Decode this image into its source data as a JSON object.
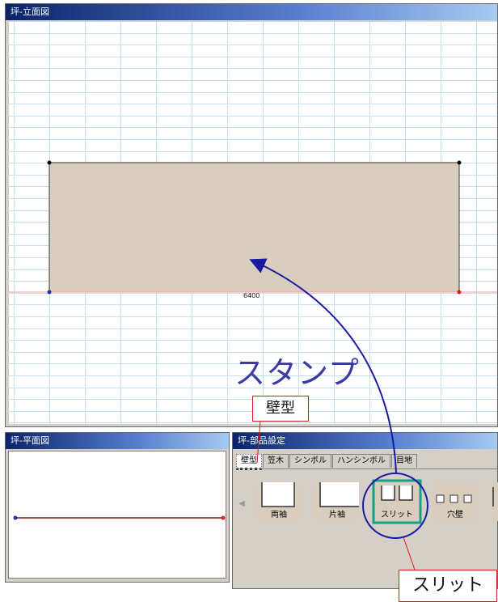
{
  "elevation_window": {
    "title": "坪-立面図",
    "dimension_label": "6400"
  },
  "plan_window": {
    "title": "坪-平面図"
  },
  "parts_window": {
    "title": "坪-部品設定",
    "tabs": [
      {
        "label": "壁型",
        "active": true
      },
      {
        "label": "笠木",
        "active": false
      },
      {
        "label": "シンボル",
        "active": false
      },
      {
        "label": "ハンシンボル",
        "active": false
      },
      {
        "label": "目地",
        "active": false
      }
    ],
    "wall_types": [
      {
        "label": "両袖",
        "icon": "wall-both-sleeves-icon"
      },
      {
        "label": "片袖",
        "icon": "wall-one-sleeve-icon"
      },
      {
        "label": "スリット",
        "icon": "wall-slit-icon",
        "selected": true
      },
      {
        "label": "穴壁",
        "icon": "wall-holes-icon"
      }
    ]
  },
  "annotations": {
    "stamp": "スタンプ",
    "wall_type_callout": "壁型",
    "slit_callout": "スリット"
  },
  "colors": {
    "wall_fill": "#d9cebd",
    "grid": "#bfe1ea",
    "arrow": "#1a1aa0",
    "callout_border": "#d91a1a",
    "highlight": "#16a085"
  }
}
